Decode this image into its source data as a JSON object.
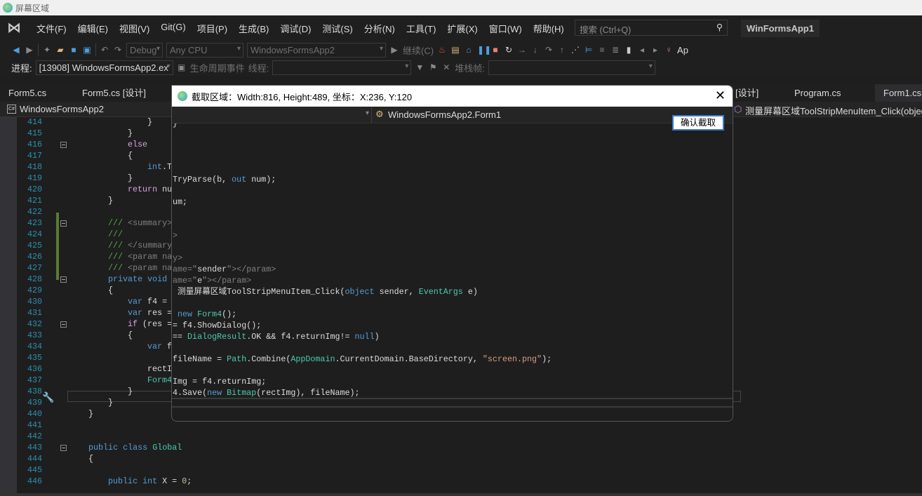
{
  "window": {
    "title": "屏幕区域"
  },
  "menu": [
    "文件(F)",
    "编辑(E)",
    "视图(V)",
    "Git(G)",
    "项目(P)",
    "生成(B)",
    "调试(D)",
    "测试(S)",
    "分析(N)",
    "工具(T)",
    "扩展(X)",
    "窗口(W)",
    "帮助(H)"
  ],
  "search": {
    "placeholder": "搜索 (Ctrl+Q)"
  },
  "solution_name": "WinFormsApp1",
  "toolbar": {
    "config": "Debug",
    "platform": "Any CPU",
    "startup": "WindowsFormsApp2",
    "continue": "继续(C)",
    "app_label": "Ap"
  },
  "debugbar": {
    "process_label": "进程:",
    "process_value": "[13908] WindowsFormsApp2.ex",
    "lifecycle": "生命周期事件",
    "thread_label": "线程:",
    "stack_label": "堆栈帧:"
  },
  "tabs": [
    {
      "label": "Form5.cs"
    },
    {
      "label": "Form5.cs [设计]"
    },
    {
      "label": "[设计]"
    },
    {
      "label": "Program.cs"
    },
    {
      "label": "Form1.cs",
      "active": true
    }
  ],
  "navbar": {
    "project": "WindowsFormsApp2",
    "member": "测量屏幕区域ToolStripMenuItem_Click(objec"
  },
  "editor": {
    "lines": [
      {
        "n": "414",
        "indent": 16,
        "t": [
          [
            "tx",
            "}"
          ]
        ]
      },
      {
        "n": "415",
        "indent": 12,
        "t": [
          [
            "tx",
            "}"
          ]
        ]
      },
      {
        "n": "416",
        "indent": 12,
        "t": [
          [
            "ct",
            "else"
          ]
        ],
        "fold": true
      },
      {
        "n": "417",
        "indent": 12,
        "t": [
          [
            "tx",
            "{"
          ]
        ]
      },
      {
        "n": "418",
        "indent": 16,
        "t": [
          [
            "kw",
            "int"
          ],
          [
            "tx",
            ".TryParse(b, "
          ],
          [
            "kw",
            "out"
          ],
          [
            "tx",
            " num);"
          ]
        ]
      },
      {
        "n": "419",
        "indent": 12,
        "t": [
          [
            "tx",
            "}"
          ]
        ]
      },
      {
        "n": "420",
        "indent": 12,
        "t": [
          [
            "ct",
            "return"
          ],
          [
            "tx",
            " num;"
          ]
        ]
      },
      {
        "n": "421",
        "indent": 8,
        "t": [
          [
            "tx",
            "}"
          ]
        ]
      },
      {
        "n": "422",
        "indent": 0,
        "t": []
      },
      {
        "n": "423",
        "indent": 8,
        "t": [
          [
            "cm",
            "/// "
          ],
          [
            "cg",
            "<summary>"
          ]
        ],
        "fold": true
      },
      {
        "n": "424",
        "indent": 8,
        "t": [
          [
            "cm",
            "///"
          ]
        ]
      },
      {
        "n": "425",
        "indent": 8,
        "t": [
          [
            "cm",
            "/// "
          ],
          [
            "cg",
            "</summary>"
          ]
        ]
      },
      {
        "n": "426",
        "indent": 8,
        "t": [
          [
            "cm",
            "/// "
          ],
          [
            "cg",
            "<param name=\"sender\"></param>"
          ]
        ]
      },
      {
        "n": "427",
        "indent": 8,
        "t": [
          [
            "cm",
            "/// "
          ],
          [
            "cg",
            "<param name=\"e\"></param>"
          ]
        ]
      },
      {
        "n": "428",
        "indent": 8,
        "t": [
          [
            "kw",
            "private void"
          ],
          [
            "tx",
            " 测量屏幕区域ToolStripMenuItem_Click("
          ]
        ],
        "fold": true
      },
      {
        "n": "429",
        "indent": 8,
        "t": [
          [
            "tx",
            "{"
          ]
        ]
      },
      {
        "n": "430",
        "indent": 12,
        "t": [
          [
            "kw",
            "var"
          ],
          [
            "tx",
            " f4 = "
          ]
        ]
      },
      {
        "n": "431",
        "indent": 12,
        "t": [
          [
            "kw",
            "var"
          ],
          [
            "tx",
            " res = "
          ]
        ]
      },
      {
        "n": "432",
        "indent": 12,
        "t": [
          [
            "ct",
            "if"
          ],
          [
            "tx",
            " (res = "
          ]
        ],
        "fold": true
      },
      {
        "n": "433",
        "indent": 12,
        "t": [
          [
            "tx",
            "{"
          ]
        ]
      },
      {
        "n": "434",
        "indent": 16,
        "t": [
          [
            "kw",
            "var"
          ],
          [
            "tx",
            " f"
          ]
        ]
      },
      {
        "n": "435",
        "indent": 0,
        "t": []
      },
      {
        "n": "436",
        "indent": 16,
        "t": [
          [
            "tx",
            "rectI"
          ]
        ]
      },
      {
        "n": "437",
        "indent": 16,
        "t": [
          [
            "ty",
            "Form4"
          ]
        ]
      },
      {
        "n": "438",
        "indent": 12,
        "t": [
          [
            "tx",
            "}"
          ]
        ]
      },
      {
        "n": "439",
        "indent": 8,
        "t": [
          [
            "tx",
            "}"
          ]
        ]
      },
      {
        "n": "440",
        "indent": 4,
        "t": [
          [
            "tx",
            "}"
          ]
        ]
      },
      {
        "n": "441",
        "indent": 0,
        "t": []
      },
      {
        "n": "442",
        "indent": 0,
        "t": []
      },
      {
        "n": "443",
        "indent": 4,
        "t": [
          [
            "kw",
            "public class"
          ],
          [
            "tx",
            " "
          ],
          [
            "ty",
            "Global"
          ]
        ],
        "fold": true
      },
      {
        "n": "444",
        "indent": 4,
        "t": [
          [
            "tx",
            "{"
          ]
        ]
      },
      {
        "n": "445",
        "indent": 0,
        "t": []
      },
      {
        "n": "446",
        "indent": 8,
        "t": [
          [
            "kw",
            "public int"
          ],
          [
            "tx",
            " X = "
          ],
          [
            "nu",
            "0"
          ],
          [
            "tx",
            ";"
          ]
        ]
      }
    ]
  },
  "dialog": {
    "title": "截取区域：Width:816, Height:489, 坐标：X:236, Y:120",
    "nav_class": "WindowsFormsApp2.Form1",
    "confirm_label": "确认截取",
    "lines": [
      {
        "row": 0,
        "t": [
          [
            "tx",
            "}"
          ]
        ]
      },
      {
        "row": 5,
        "t": [
          [
            "tx",
            "TryParse(b, "
          ],
          [
            "kw",
            "out"
          ],
          [
            "tx",
            " num);"
          ]
        ]
      },
      {
        "row": 7,
        "t": [
          [
            "tx",
            "um;"
          ]
        ]
      },
      {
        "row": 10,
        "t": [
          [
            "cg",
            ">"
          ]
        ]
      },
      {
        "row": 12,
        "t": [
          [
            "cg",
            "y>"
          ]
        ]
      },
      {
        "row": 13,
        "t": [
          [
            "cg",
            "ame=\""
          ],
          [
            "tx",
            "sender"
          ],
          [
            "cg",
            "\"></param>"
          ]
        ]
      },
      {
        "row": 14,
        "t": [
          [
            "cg",
            "ame=\""
          ],
          [
            "tx",
            "e"
          ],
          [
            "cg",
            "\"></param>"
          ]
        ]
      },
      {
        "row": 15,
        "t": [
          [
            "tx",
            " 测量屏幕区域ToolStripMenuItem_Click("
          ],
          [
            "kw",
            "object"
          ],
          [
            "tx",
            " sender, "
          ],
          [
            "ty",
            "EventArgs"
          ],
          [
            "tx",
            " e)"
          ]
        ]
      },
      {
        "row": 17,
        "t": [
          [
            "kw",
            " new "
          ],
          [
            "ty",
            "Form4"
          ],
          [
            "tx",
            "();"
          ]
        ]
      },
      {
        "row": 18,
        "t": [
          [
            "tx",
            "= f4.ShowDialog();"
          ]
        ]
      },
      {
        "row": 19,
        "t": [
          [
            "tx",
            "== "
          ],
          [
            "ty",
            "DialogResult"
          ],
          [
            "tx",
            ".OK && f4.returnImg!= "
          ],
          [
            "kw",
            "null"
          ],
          [
            "tx",
            ")"
          ]
        ]
      },
      {
        "row": 21,
        "t": [
          [
            "tx",
            "fileName = "
          ],
          [
            "ty",
            "Path"
          ],
          [
            "tx",
            ".Combine("
          ],
          [
            "ty",
            "AppDomain"
          ],
          [
            "tx",
            ".CurrentDomain.BaseDirectory, "
          ],
          [
            "st",
            "\"screen.png\""
          ],
          [
            "tx",
            ");"
          ]
        ]
      },
      {
        "row": 23,
        "t": [
          [
            "tx",
            "Img = f4.returnImg;"
          ]
        ]
      },
      {
        "row": 24,
        "t": [
          [
            "tx",
            "4.Save("
          ],
          [
            "kw",
            "new"
          ],
          [
            "tx",
            " "
          ],
          [
            "ty",
            "Bitmap"
          ],
          [
            "tx",
            "(rectImg), fileName);"
          ]
        ]
      }
    ]
  }
}
